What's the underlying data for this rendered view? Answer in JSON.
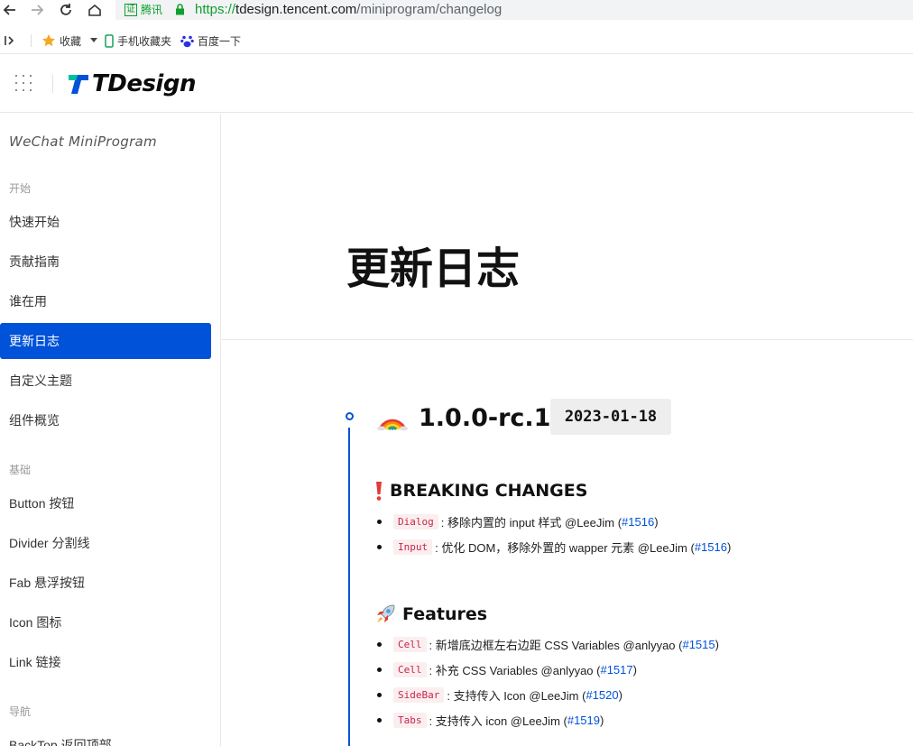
{
  "browser": {
    "cert_badge": "证",
    "cert_name": "腾讯",
    "url_scheme": "https://",
    "url_host": "tdesign.tencent.com",
    "url_path": "/miniprogram/changelog",
    "bookmarks": [
      {
        "label": "收藏",
        "icon": "star-icon"
      },
      {
        "label": "手机收藏夹",
        "icon": "phone-icon"
      },
      {
        "label": "百度一下",
        "icon": "baidu-paw-icon"
      }
    ],
    "colors": {
      "secure": "#0e9f2e",
      "url_bg": "#f1f3f4"
    }
  },
  "header": {
    "logo_text": "TDesign",
    "colors": {
      "brand_blue": "#0052d9",
      "brand_green": "#00c0a0"
    }
  },
  "sidebar": {
    "title": "WeChat MiniProgram",
    "groups": [
      {
        "label": "开始",
        "items": [
          {
            "label": "快速开始"
          },
          {
            "label": "贡献指南"
          },
          {
            "label": "谁在用"
          },
          {
            "label": "更新日志",
            "active": true
          },
          {
            "label": "自定义主题"
          },
          {
            "label": "组件概览"
          }
        ]
      },
      {
        "label": "基础",
        "items": [
          {
            "label": "Button 按钮"
          },
          {
            "label": "Divider 分割线"
          },
          {
            "label": "Fab 悬浮按钮"
          },
          {
            "label": "Icon 图标"
          },
          {
            "label": "Link 链接"
          }
        ]
      },
      {
        "label": "导航",
        "items": [
          {
            "label": "BackTop 返回顶部"
          }
        ]
      }
    ],
    "colors": {
      "active_bg": "#0052d9"
    }
  },
  "main": {
    "page_title": "更新日志",
    "release": {
      "version": "1.0.0-rc.1",
      "date": "2023-01-18",
      "emoji": "rainbow-icon",
      "sections": [
        {
          "heading": "BREAKING CHANGES",
          "icon": "exclamation-icon",
          "items": [
            {
              "tag": "Dialog",
              "text": ": 移除内置的 input 样式 @LeeJim (",
              "pr": "#1516",
              "close": ")"
            },
            {
              "tag": "Input",
              "text": ": 优化 DOM，移除外置的 wapper 元素 @LeeJim (",
              "pr": "#1516",
              "close": ")"
            }
          ]
        },
        {
          "heading": "Features",
          "icon": "rocket-icon",
          "items": [
            {
              "tag": "Cell",
              "text": ": 新增底边框左右边距 CSS Variables @anlyyao (",
              "pr": "#1515",
              "close": ")"
            },
            {
              "tag": "Cell",
              "text": ": 补充 CSS Variables @anlyyao (",
              "pr": "#1517",
              "close": ")"
            },
            {
              "tag": "SideBar",
              "text": ": 支持传入 Icon @LeeJim (",
              "pr": "#1520",
              "close": ")"
            },
            {
              "tag": "Tabs",
              "text": ": 支持传入 icon @LeeJim (",
              "pr": "#1519",
              "close": ")"
            }
          ]
        }
      ]
    },
    "colors": {
      "timeline": "#0052d9",
      "tag_text": "#c7254e",
      "tag_bg": "#fbeeee",
      "link": "#0052d9"
    }
  }
}
